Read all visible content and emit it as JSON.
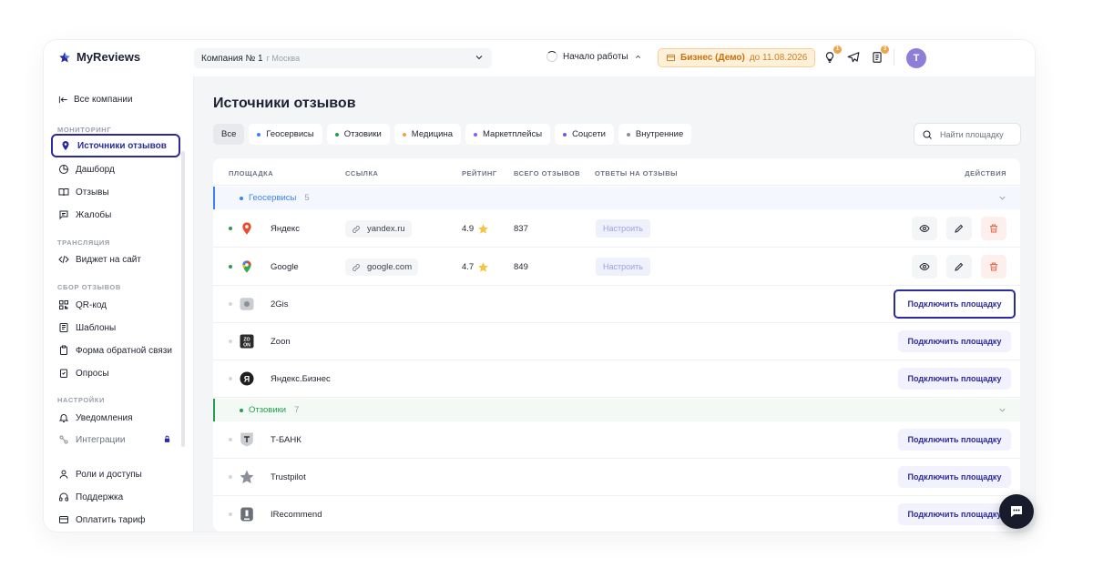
{
  "app": {
    "name": "MyReviews"
  },
  "header": {
    "company": "Компания № 1",
    "city": "г Москва",
    "start_work": "Начало работы",
    "plan": "Бизнес (Демо)",
    "plan_until": "до 11.08.2026",
    "notif_badge_1": "1",
    "notif_badge_2": "3",
    "avatar_letter": "T"
  },
  "sidebar": {
    "back": "Все компании",
    "sections": {
      "monitoring": "МОНИТОРИНГ",
      "broadcast": "ТРАНСЛЯЦИЯ",
      "collect": "СБОР ОТЗЫВОВ",
      "settings": "НАСТРОЙКИ"
    },
    "items": {
      "sources": "Источники отзывов",
      "dashboard": "Дашборд",
      "reviews": "Отзывы",
      "complaints": "Жалобы",
      "widget": "Виджет на сайт",
      "qr": "QR-код",
      "templates": "Шаблоны",
      "feedback": "Форма обратной связи",
      "polls": "Опросы",
      "notifications": "Уведомления",
      "integrations": "Интеграции",
      "roles": "Роли и доступы",
      "support": "Поддержка",
      "pay": "Оплатить тариф"
    }
  },
  "main": {
    "title": "Источники отзывов",
    "filters": {
      "all": "Все",
      "geo": "Геосервисы",
      "rev": "Отзовики",
      "med": "Медицина",
      "market": "Маркетплейсы",
      "social": "Соцсети",
      "internal": "Внутренние"
    },
    "search_placeholder": "Найти площадку",
    "columns": {
      "platform": "ПЛОЩАДКА",
      "link": "ССЫЛКА",
      "rating": "РЕЙТИНГ",
      "total": "ВСЕГО ОТЗЫВОВ",
      "answers": "ОТВЕТЫ НА ОТЗЫВЫ",
      "actions": "ДЕЙСТВИЯ"
    },
    "groups": {
      "geo": {
        "label": "Геосервисы",
        "count": "5"
      },
      "rev": {
        "label": "Отзовики",
        "count": "7"
      }
    },
    "rows": {
      "yandex": {
        "name": "Яндекс",
        "link": "yandex.ru",
        "rating": "4.9",
        "total": "837",
        "setup": "Настроить"
      },
      "google": {
        "name": "Google",
        "link": "google.com",
        "rating": "4.7",
        "total": "849",
        "setup": "Настроить"
      },
      "twogis": {
        "name": "2Gis"
      },
      "zoon": {
        "name": "Zoon"
      },
      "ybiz": {
        "name": "Яндекс.Бизнес"
      },
      "tbank": {
        "name": "Т-БАНК"
      },
      "trustpilot": {
        "name": "Trustpilot"
      },
      "irecommend": {
        "name": "IRecommend"
      }
    },
    "connect_label": "Подключить площадку"
  },
  "colors": {
    "accent": "#2d2a9e",
    "geo": "#3b82f6",
    "rev": "#22a04b",
    "med": "#f0a24a",
    "market": "#8b5cf6",
    "social": "#6d5dd3",
    "internal": "#8a8f99",
    "plan_bg": "#fff0d9",
    "delete": "#e06a4a"
  }
}
